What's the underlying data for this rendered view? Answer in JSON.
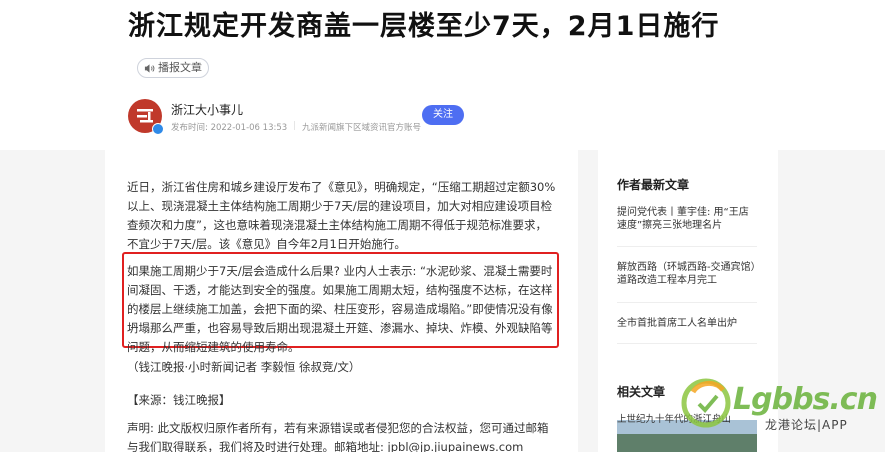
{
  "article": {
    "title": "浙江规定开发商盖一层楼至少7天，2月1日施行",
    "audio_label": "播报文章",
    "author": {
      "name": "浙江大小事儿",
      "publish_info": "发布时间: 2022-01-06 13:53",
      "source": "九派新闻旗下区域资讯官方账号"
    },
    "follow_label": "关注",
    "paragraphs": {
      "p1": "近日，浙江省住房和城乡建设厅发布了《意见》，明确规定，“压缩工期超过定额30%以上、现浇混凝土主体结构施工周期少于7天/层的建设项目，加大对相应建设项目检查频次和力度”，这也意味着现浇混凝土主体结构施工周期不得低于规范标准要求，不宜少于7天/层。该《意见》自今年2月1日开始施行。",
      "p2": "如果施工周期少于7天/层会造成什么后果? 业内人士表示: “水泥砂浆、混凝土需要时间凝固、干透，才能达到安全的强度。如果施工周期太短，结构强度不达标，在这样的楼层上继续施工加盖，会把下面的梁、柱压变形，容易造成塌陷。”即使情况没有像坍塌那么严重，也容易导致后期出现混凝土开筵、渗漏水、掉块、炸模、外观缺陷等问题，从而缩短建筑的使用寿命。",
      "p3": "（钱江晚报·小时新闻记者 李毅恒 徐叔竞/文）",
      "p4": "【来源：钱江晚报】",
      "p5": "声明: 此文版权归原作者所有，若有来源错误或者侵犯您的合法权益，您可通过邮箱与我们取得联系，我们将及时进行处理。邮箱地址: jpbl@jp.jiupainews.com"
    }
  },
  "sidebar": {
    "latest_heading": "作者最新文章",
    "latest_items": [
      "提问党代表丨董宇佳: 用“王店速度”擦亮三张地理名片",
      "解放西路（环城西路-交通宾馆）道路改造工程本月完工",
      "全市首批首席工人名单出炉"
    ],
    "related_heading": "相关文章",
    "related_items": [
      "上世纪九十年代的浙江舟山"
    ]
  },
  "watermark": {
    "brand": "Lgbbs.cn",
    "sub": "龙港论坛|APP"
  },
  "colors": {
    "accent": "#4e6ef2",
    "highlight_border": "#e02020",
    "avatar": "#c0392b",
    "watermark_green": "#69b23a"
  }
}
